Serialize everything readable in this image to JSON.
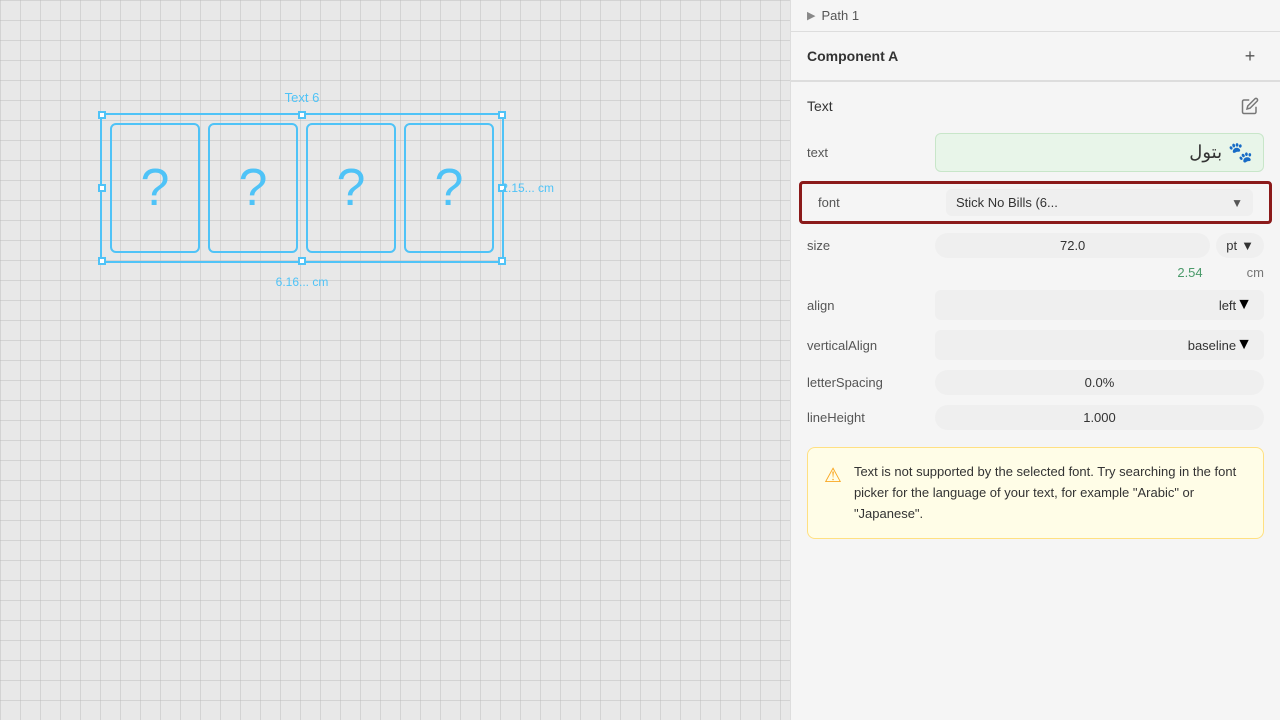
{
  "breadcrumb": {
    "icon": "▶",
    "text": "Path 1"
  },
  "component": {
    "title": "Component A",
    "add_label": "+"
  },
  "section": {
    "title": "Text",
    "edit_icon": "✏"
  },
  "properties": {
    "text_label": "text",
    "text_value": "بتول",
    "paw_icon": "🐾",
    "font_label": "font",
    "font_value": "Stick No Bills (6...",
    "size_label": "size",
    "size_value": "72.0",
    "size_unit": "pt",
    "size_cm_value": "2.54",
    "size_cm_unit": "cm",
    "align_label": "align",
    "align_value": "left",
    "vertical_align_label": "verticalAlign",
    "vertical_align_value": "baseline",
    "letter_spacing_label": "letterSpacing",
    "letter_spacing_value": "0.0%",
    "line_height_label": "lineHeight",
    "line_height_value": "1.000"
  },
  "warning": {
    "icon": "⚠",
    "text": "Text is not supported by the selected font. Try searching in the font picker for the language of your text, for example \"Arabic\" or \"Japanese\"."
  },
  "canvas": {
    "selection_label": "Text 6",
    "width_label": "6.16... cm",
    "height_label": "2.15... cm",
    "cards": [
      "?",
      "?",
      "?",
      "?"
    ]
  }
}
